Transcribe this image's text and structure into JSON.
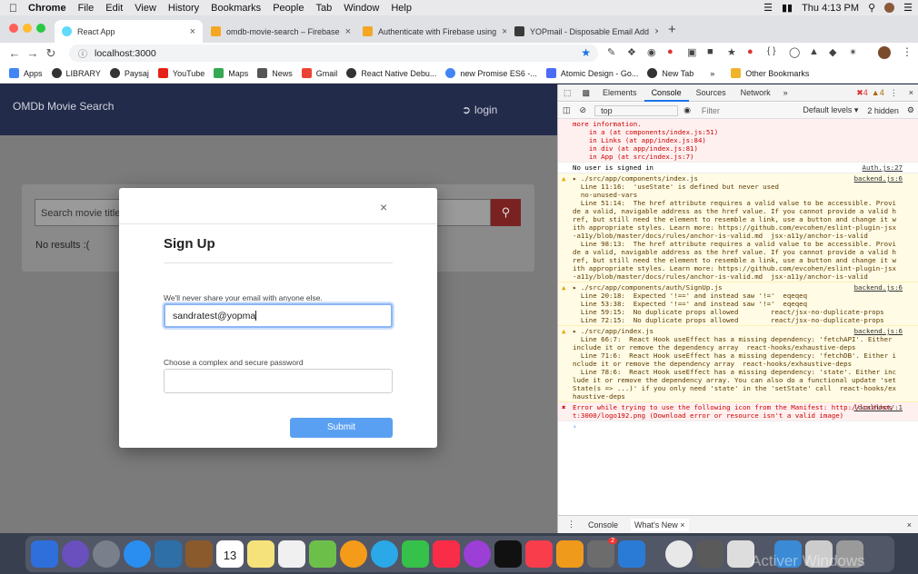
{
  "menubar": {
    "apple": "",
    "app": "Chrome",
    "items": [
      "File",
      "Edit",
      "View",
      "History",
      "Bookmarks",
      "People",
      "Tab",
      "Window",
      "Help"
    ],
    "clock": "Thu 4:13 PM"
  },
  "tabs": [
    {
      "label": "React App",
      "active": true,
      "color": "#61dafb"
    },
    {
      "label": "omdb-movie-search – Firebase",
      "active": false,
      "color": "#f5a623"
    },
    {
      "label": "Authenticate with Firebase using",
      "active": false,
      "color": "#f5a623"
    },
    {
      "label": "YOPmail - Disposable Email Add",
      "active": false,
      "color": "#3a3a3a"
    }
  ],
  "omnibox": {
    "url": "localhost:3000"
  },
  "bookmarks": {
    "items": [
      {
        "label": "Apps",
        "color": "#4285f4"
      },
      {
        "label": "LIBRARY",
        "color": "#333"
      },
      {
        "label": "Paysaj",
        "color": "#333"
      },
      {
        "label": "YouTube",
        "color": "#e62117"
      },
      {
        "label": "Maps",
        "color": "#34a853"
      },
      {
        "label": "News",
        "color": "#333"
      },
      {
        "label": "Gmail",
        "color": "#ea4335"
      },
      {
        "label": "React Native Debu...",
        "color": "#333"
      },
      {
        "label": "new Promise ES6 -...",
        "color": "#4285f4"
      },
      {
        "label": "Atomic Design - Go...",
        "color": "#4a6cf7"
      },
      {
        "label": "New Tab",
        "color": "#333"
      }
    ],
    "more": "»",
    "other": "Other Bookmarks"
  },
  "app": {
    "brand": "OMDb Movie Search",
    "login": "login",
    "search_placeholder": "Search movie title",
    "no_results": "No results :("
  },
  "modal": {
    "title": "Sign Up",
    "close": "×",
    "email_label": "We'll never share your email with anyone else.",
    "email_value": "sandratest@yopma",
    "password_label": "Choose a complex and secure password",
    "submit": "Submit"
  },
  "devtools": {
    "tabs": [
      "Elements",
      "Console",
      "Sources",
      "Network"
    ],
    "selected_tab": "Console",
    "errors": "4",
    "warnings": "4",
    "context": "top",
    "filter_placeholder": "Filter",
    "levels": "Default levels ▾",
    "hidden": "2 hidden",
    "messages": [
      {
        "type": "err",
        "text": "more information.\n    in a (at components/index.js:51)\n    in Links (at app/index.js:84)\n    in div (at app/index.js:81)\n    in App (at src/index.js:7)",
        "src": ""
      },
      {
        "type": "log",
        "text": "No user is signed in",
        "src": "Auth.js:27"
      },
      {
        "type": "warn",
        "text": "▸ ./src/app/components/index.js\n  Line 11:16:  'useState' is defined but never used\n  no-unused-vars\n  Line 51:14:  The href attribute requires a valid value to be accessible. Provide a valid, navigable address as the href value. If you cannot provide a valid href, but still need the element to resemble a link, use a button and change it with appropriate styles. Learn more: https://github.com/evcohen/eslint-plugin-jsx-a11y/blob/master/docs/rules/anchor-is-valid.md  jsx-a11y/anchor-is-valid\n  Line 98:13:  The href attribute requires a valid value to be accessible. Provide a valid, navigable address as the href value. If you cannot provide a valid href, but still need the element to resemble a link, use a button and change it with appropriate styles. Learn more: https://github.com/evcohen/eslint-plugin-jsx-a11y/blob/master/docs/rules/anchor-is-valid.md  jsx-a11y/anchor-is-valid",
        "src": "backend.js:6"
      },
      {
        "type": "warn",
        "text": "▸ ./src/app/components/auth/SignUp.js\n  Line 20:18:  Expected '!==' and instead saw '!='  eqeqeq\n  Line 53:38:  Expected '!==' and instead saw '!='  eqeqeq\n  Line 59:15:  No duplicate props allowed        react/jsx-no-duplicate-props\n  Line 72:15:  No duplicate props allowed        react/jsx-no-duplicate-props",
        "src": "backend.js:6"
      },
      {
        "type": "warn",
        "text": "▸ ./src/app/index.js\n  Line 66:7:  React Hook useEffect has a missing dependency: 'fetchAPI'. Either include it or remove the dependency array  react-hooks/exhaustive-deps\n  Line 71:6:  React Hook useEffect has a missing dependency: 'fetchDB'. Either include it or remove the dependency array  react-hooks/exhaustive-deps\n  Line 78:6:  React Hook useEffect has a missing dependency: 'state'. Either include it or remove the dependency array. You can also do a functional update 'setState(s => ...)' if you only need 'state' in the 'setState' call  react-hooks/exhaustive-deps",
        "src": "backend.js:6"
      },
      {
        "type": "err",
        "text": "Error while trying to use the following icon from the Manifest: http://localhost:3000/logo192.png (Download error or resource isn't a valid image)",
        "src": "localhost/:1"
      },
      {
        "type": "log",
        "text": "›",
        "src": ""
      }
    ],
    "drawer_tabs": [
      "Console",
      "What's New"
    ]
  },
  "dock": {
    "icons": [
      "#2f6fdc",
      "#6a4fbf",
      "#7a7f8c",
      "#2a8ef0",
      "#2e6fa8",
      "#8a5a2c",
      "#ffffff",
      "#f5e27a",
      "#f0f0f0",
      "#6cc04a",
      "#f49b1a",
      "#2aa8e8",
      "#35c14a",
      "#fa2d48",
      "#9b3fd6",
      "#111111",
      "#fa3d4b",
      "#f09a1b",
      "#6c6c6c",
      "#2a7bd6",
      "#e8e8e8",
      "#5a5a5a",
      "#dddddd",
      "#3a8ad6",
      "#cccccc",
      "#9a9a9a"
    ],
    "calendar_day": "13",
    "badge": "2"
  },
  "watermark": "Activer Windows"
}
